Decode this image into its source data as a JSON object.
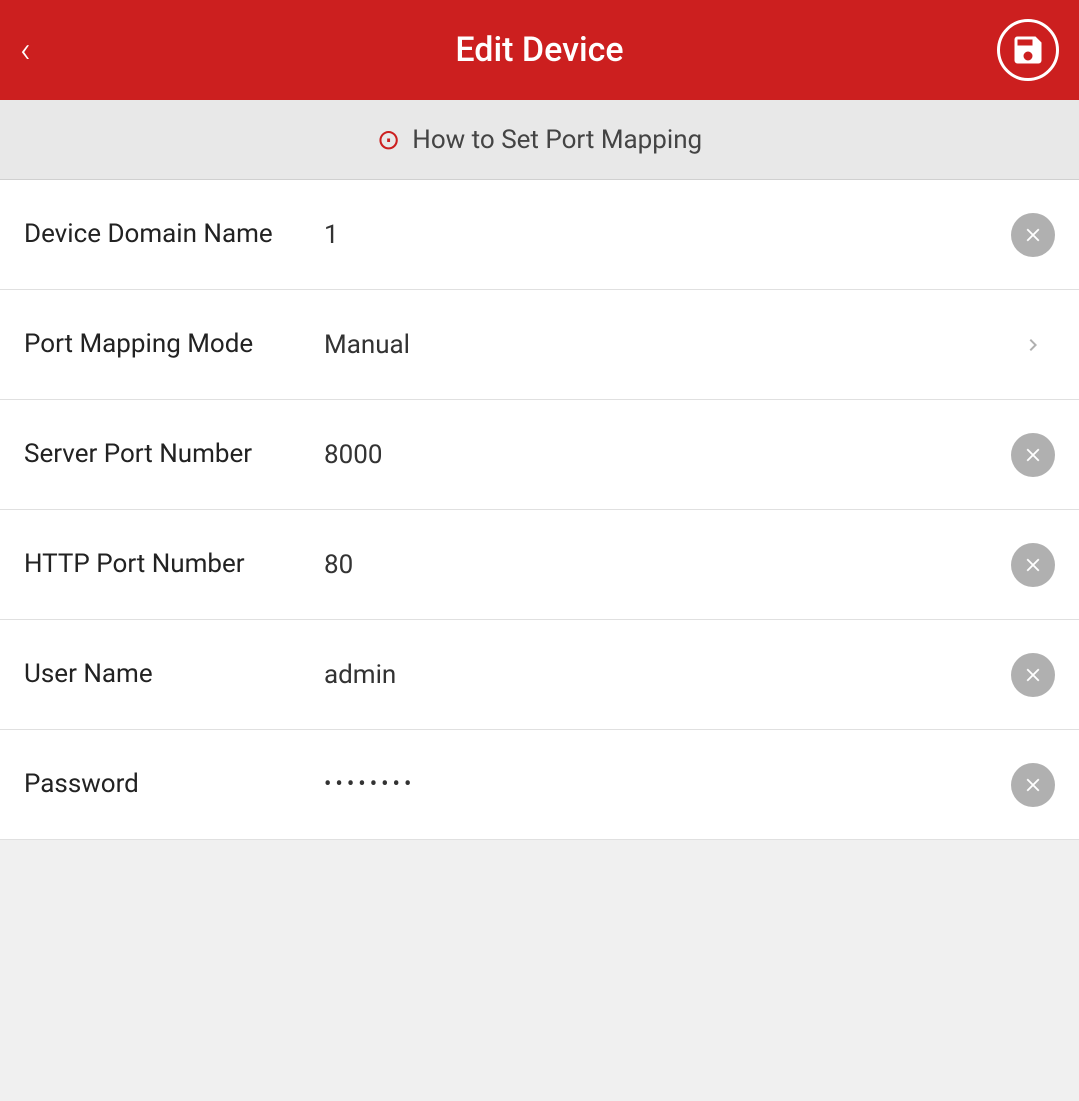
{
  "header": {
    "back_label": "‹",
    "title": "Edit Device",
    "save_icon": "save-icon"
  },
  "info_bar": {
    "icon": "?",
    "text": "How to Set Port Mapping"
  },
  "form": {
    "rows": [
      {
        "id": "device-domain-name",
        "label": "Device Domain Name",
        "value": "1",
        "type": "text",
        "control": "clear"
      },
      {
        "id": "port-mapping-mode",
        "label": "Port Mapping Mode",
        "value": "Manual",
        "type": "select",
        "control": "chevron"
      },
      {
        "id": "server-port-number",
        "label": "Server Port Number",
        "value": "8000",
        "type": "text",
        "control": "clear"
      },
      {
        "id": "http-port-number",
        "label": "HTTP Port Number",
        "value": "80",
        "type": "text",
        "control": "clear"
      },
      {
        "id": "user-name",
        "label": "User Name",
        "value": "admin",
        "type": "text",
        "control": "clear"
      },
      {
        "id": "password",
        "label": "Password",
        "value": "••••••••",
        "type": "password",
        "control": "clear"
      }
    ]
  }
}
